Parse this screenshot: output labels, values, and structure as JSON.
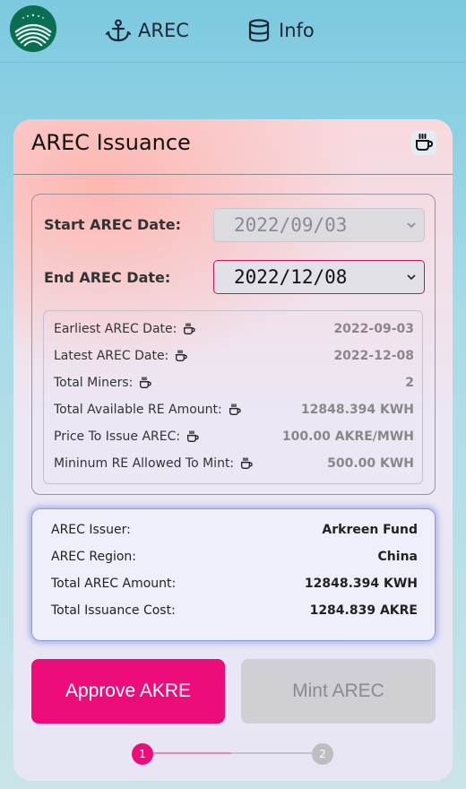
{
  "nav": {
    "arec_label": "AREC",
    "info_label": "Info"
  },
  "card": {
    "title": "AREC Issuance",
    "start_label": "Start AREC Date:",
    "start_value": "2022/09/03",
    "end_label": "End AREC Date:",
    "end_value": "2022/12/08"
  },
  "info": {
    "rows": [
      {
        "label": "Earliest AREC Date:",
        "value": "2022-09-03"
      },
      {
        "label": "Latest AREC Date:",
        "value": "2022-12-08"
      },
      {
        "label": "Total Miners:",
        "value": "2"
      },
      {
        "label": "Total Available RE Amount:",
        "value": "12848.394 KWH"
      },
      {
        "label": "Price To Issue AREC:",
        "value": "100.00 AKRE/MWH"
      },
      {
        "label": "Mininum RE Allowed To Mint:",
        "value": "500.00 KWH"
      }
    ]
  },
  "summary": {
    "rows": [
      {
        "label": "AREC Issuer:",
        "value": "Arkreen Fund"
      },
      {
        "label": "AREC Region:",
        "value": "China"
      },
      {
        "label": "Total AREC Amount:",
        "value": "12848.394 KWH"
      },
      {
        "label": "Total Issuance Cost:",
        "value": "1284.839 AKRE"
      }
    ]
  },
  "buttons": {
    "approve_label": "Approve AKRE",
    "mint_label": "Mint AREC"
  },
  "stepper": {
    "step1": "1",
    "step2": "2"
  },
  "colors": {
    "accent": "#ec0c7a",
    "logo": "#0b6e52",
    "summary_border": "#8a9ddb"
  }
}
